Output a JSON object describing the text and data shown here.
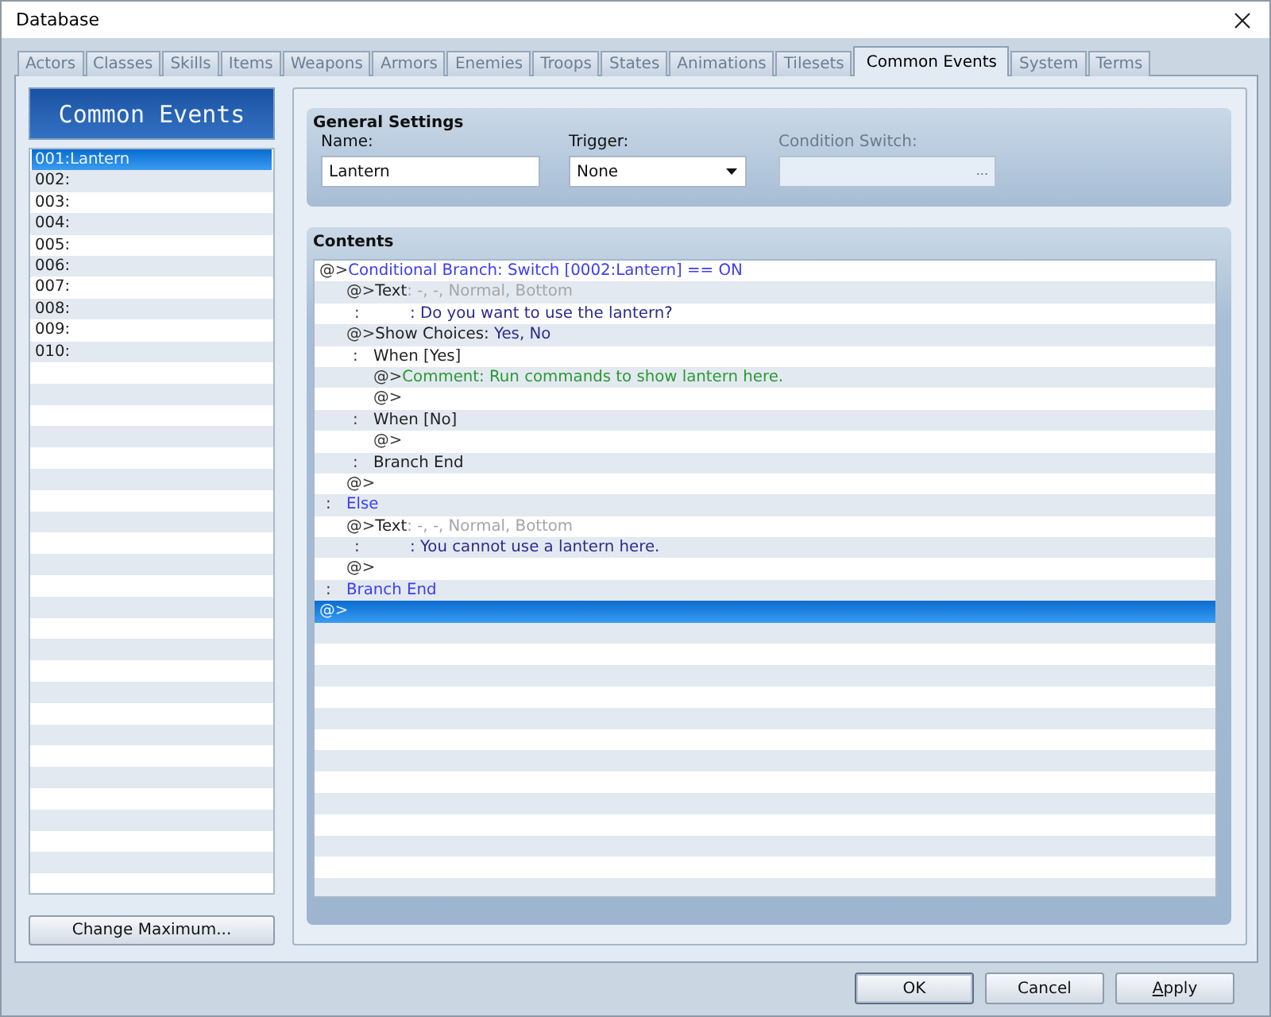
{
  "window": {
    "title": "Database"
  },
  "tabs": [
    {
      "label": "Actors",
      "selected": false
    },
    {
      "label": "Classes",
      "selected": false
    },
    {
      "label": "Skills",
      "selected": false
    },
    {
      "label": "Items",
      "selected": false
    },
    {
      "label": "Weapons",
      "selected": false
    },
    {
      "label": "Armors",
      "selected": false
    },
    {
      "label": "Enemies",
      "selected": false
    },
    {
      "label": "Troops",
      "selected": false
    },
    {
      "label": "States",
      "selected": false
    },
    {
      "label": "Animations",
      "selected": false
    },
    {
      "label": "Tilesets",
      "selected": false
    },
    {
      "label": "Common Events",
      "selected": true
    },
    {
      "label": "System",
      "selected": false
    },
    {
      "label": "Terms",
      "selected": false
    }
  ],
  "sidebar": {
    "header": "Common Events",
    "items": [
      {
        "label": "001:Lantern",
        "selected": true
      },
      {
        "label": "002:",
        "selected": false
      },
      {
        "label": "003:",
        "selected": false
      },
      {
        "label": "004:",
        "selected": false
      },
      {
        "label": "005:",
        "selected": false
      },
      {
        "label": "006:",
        "selected": false
      },
      {
        "label": "007:",
        "selected": false
      },
      {
        "label": "008:",
        "selected": false
      },
      {
        "label": "009:",
        "selected": false
      },
      {
        "label": "010:",
        "selected": false
      }
    ],
    "button": "Change Maximum..."
  },
  "general_settings": {
    "title": "General Settings",
    "name": {
      "label": "Name:",
      "value": "Lantern"
    },
    "trigger": {
      "label": "Trigger:",
      "value": "None"
    },
    "condition_switch": {
      "label": "Condition Switch:",
      "button": "...",
      "disabled": true
    }
  },
  "contents": {
    "title": "Contents",
    "lines": [
      {
        "kind": "command",
        "marker": "@>",
        "segments": [
          {
            "kind": "branch",
            "text": "Conditional Branch: Switch [0002:Lantern] == ON"
          }
        ],
        "selected": false,
        "children": [
          {
            "kind": "command",
            "marker": "@>",
            "segments": [
              {
                "kind": "plain",
                "text": "Text"
              },
              {
                "kind": "muted",
                "text": ": -, -, Normal, Bottom"
              }
            ],
            "selected": false
          },
          {
            "kind": "continuation",
            "marker": ":",
            "segments": [
              {
                "kind": "message",
                "text": ": Do you want to use the lantern?"
              }
            ],
            "selected": false
          },
          {
            "kind": "command",
            "marker": "@>",
            "segments": [
              {
                "kind": "plain",
                "text": "Show Choices:"
              },
              {
                "kind": "message",
                "text": "Yes, No"
              }
            ],
            "selected": false
          },
          {
            "kind": "label",
            "marker": ":",
            "segments": [
              {
                "kind": "plain",
                "text": "When [Yes]"
              }
            ],
            "selected": false,
            "children": [
              {
                "kind": "command",
                "marker": "@>",
                "segments": [
                  {
                    "kind": "comment",
                    "text": "Comment: Run commands to show lantern here."
                  }
                ],
                "selected": false
              },
              {
                "kind": "command",
                "marker": "@>",
                "selected": false
              }
            ]
          },
          {
            "kind": "label",
            "marker": ":",
            "segments": [
              {
                "kind": "plain",
                "text": "When [No]"
              }
            ],
            "selected": false,
            "children": [
              {
                "kind": "command",
                "marker": "@>",
                "selected": false
              }
            ]
          },
          {
            "kind": "label",
            "marker": ":",
            "segments": [
              {
                "kind": "plain",
                "text": "Branch End"
              }
            ],
            "selected": false
          },
          {
            "kind": "command",
            "marker": "@>",
            "selected": false
          }
        ]
      },
      {
        "kind": "label",
        "marker": ":",
        "segments": [
          {
            "kind": "branch",
            "text": "Else"
          }
        ],
        "selected": false,
        "children": [
          {
            "kind": "command",
            "marker": "@>",
            "segments": [
              {
                "kind": "plain",
                "text": "Text"
              },
              {
                "kind": "muted",
                "text": ": -, -, Normal, Bottom"
              }
            ],
            "selected": false
          },
          {
            "kind": "continuation",
            "marker": ":",
            "segments": [
              {
                "kind": "message",
                "text": ": You cannot use a lantern here."
              }
            ],
            "selected": false
          },
          {
            "kind": "command",
            "marker": "@>",
            "selected": false
          }
        ]
      },
      {
        "kind": "label",
        "marker": ":",
        "segments": [
          {
            "kind": "branch",
            "text": "Branch End"
          }
        ],
        "selected": false
      },
      {
        "kind": "command",
        "marker": "@>",
        "selected": true
      }
    ]
  },
  "buttons": [
    {
      "label": "OK",
      "default": true,
      "underline_first": false
    },
    {
      "label": "Cancel",
      "default": false,
      "underline_first": false
    },
    {
      "label": "Apply",
      "default": false,
      "underline_first": true
    }
  ]
}
